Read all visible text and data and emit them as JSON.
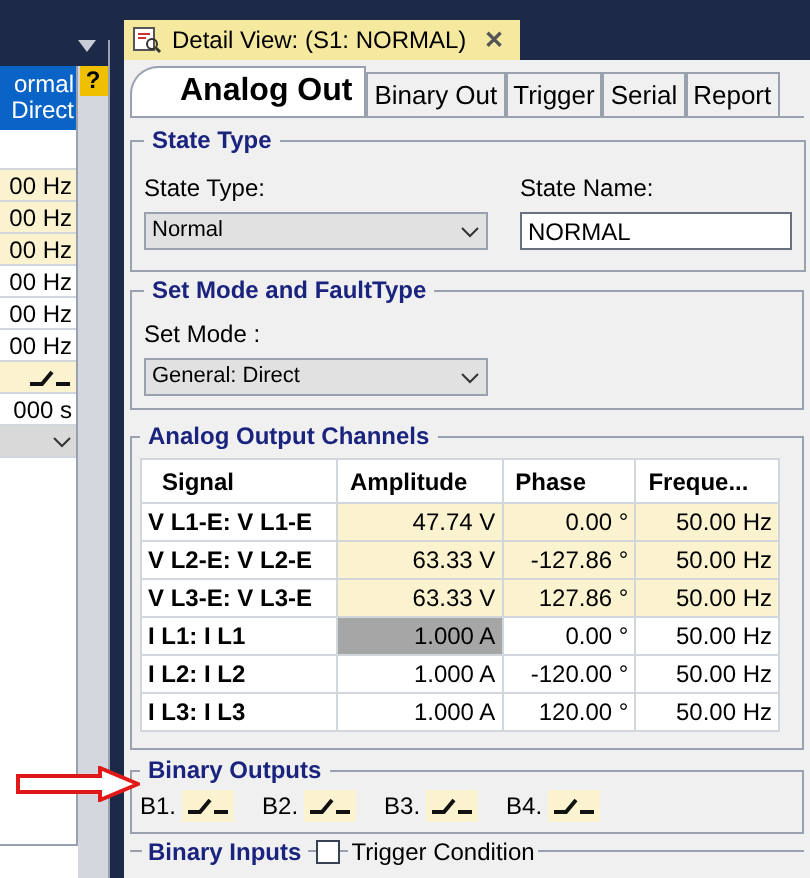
{
  "left_panel": {
    "selected_cell": [
      "ormal",
      "Direct"
    ],
    "help_button": "?",
    "rows": [
      {
        "kind": "blank"
      },
      {
        "kind": "text",
        "text": "00 Hz",
        "highlighted": true
      },
      {
        "kind": "text",
        "text": "00 Hz",
        "highlighted": true
      },
      {
        "kind": "text",
        "text": "00 Hz",
        "highlighted": true
      },
      {
        "kind": "text",
        "text": "00 Hz",
        "highlighted": false
      },
      {
        "kind": "text",
        "text": "00 Hz",
        "highlighted": false
      },
      {
        "kind": "text",
        "text": "00 Hz",
        "highlighted": false
      },
      {
        "kind": "switch",
        "highlighted": true
      },
      {
        "kind": "text",
        "text": "000 s",
        "highlighted": false
      },
      {
        "kind": "dropdown"
      }
    ]
  },
  "document_tab": {
    "title": "Detail View: (S1: NORMAL)",
    "close": "✕"
  },
  "tabs": [
    {
      "label": "Analog Out",
      "selected": true
    },
    {
      "label": "Binary Out",
      "selected": false
    },
    {
      "label": "Trigger",
      "selected": false
    },
    {
      "label": "Serial",
      "selected": false
    },
    {
      "label": "Report",
      "selected": false
    }
  ],
  "state_type": {
    "title": "State Type",
    "type_label": "State Type:",
    "type_value": "Normal",
    "name_label": "State Name:",
    "name_value": "NORMAL"
  },
  "set_mode": {
    "title": "Set Mode and FaultType",
    "label": "Set Mode :",
    "value": "General: Direct"
  },
  "analog_channels": {
    "title": "Analog Output Channels",
    "columns": [
      "Signal",
      "Amplitude",
      "Phase",
      "Freque..."
    ],
    "rows": [
      {
        "signal": "V L1-E: V L1-E",
        "amplitude": "47.74 V",
        "phase": "0.00 °",
        "frequency": "50.00 Hz",
        "highlighted": true,
        "selected": false
      },
      {
        "signal": "V L2-E: V L2-E",
        "amplitude": "63.33 V",
        "phase": "-127.86 °",
        "frequency": "50.00 Hz",
        "highlighted": true,
        "selected": false
      },
      {
        "signal": "V L3-E: V L3-E",
        "amplitude": "63.33 V",
        "phase": "127.86 °",
        "frequency": "50.00 Hz",
        "highlighted": true,
        "selected": false
      },
      {
        "signal": "I L1: I L1",
        "amplitude": "1.000 A",
        "phase": "0.00 °",
        "frequency": "50.00 Hz",
        "highlighted": false,
        "selected": true
      },
      {
        "signal": "I L2: I L2",
        "amplitude": "1.000 A",
        "phase": "-120.00 °",
        "frequency": "50.00 Hz",
        "highlighted": false,
        "selected": false
      },
      {
        "signal": "I L3: I L3",
        "amplitude": "1.000 A",
        "phase": "120.00 °",
        "frequency": "50.00 Hz",
        "highlighted": false,
        "selected": false
      }
    ]
  },
  "binary_outputs": {
    "title": "Binary Outputs",
    "outputs": [
      {
        "label": "B1.",
        "closed": false
      },
      {
        "label": "B2.",
        "closed": false
      },
      {
        "label": "B3.",
        "closed": false
      },
      {
        "label": "B4.",
        "closed": false
      }
    ]
  },
  "binary_inputs": {
    "title": "Binary Inputs",
    "trigger_label": "Trigger Condition",
    "trigger_checked": false
  }
}
